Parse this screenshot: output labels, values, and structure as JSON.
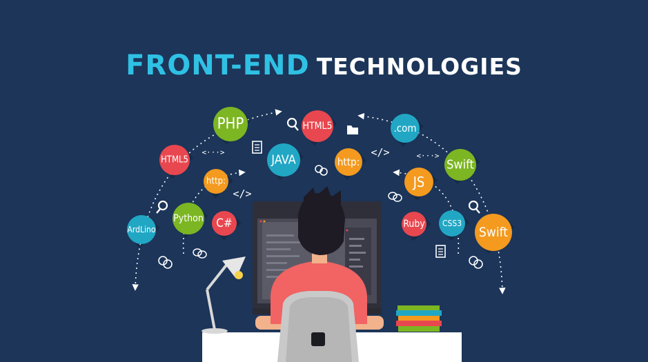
{
  "title": {
    "part1": "FRONT-END",
    "part2": "TECHNOLOGIES"
  },
  "colors": {
    "background": "#1c3559",
    "title_accent": "#2fc1e4",
    "red": "#e8474f",
    "green": "#7cb622",
    "teal": "#21a7c4",
    "orange": "#f39a1f"
  },
  "bubbles": [
    {
      "id": "php",
      "label": "PHP",
      "color": "green"
    },
    {
      "id": "html5-top",
      "label": "HTML5",
      "color": "red"
    },
    {
      "id": "com",
      "label": ".com",
      "color": "teal"
    },
    {
      "id": "html5-left",
      "label": "HTML5",
      "color": "red"
    },
    {
      "id": "java",
      "label": "JAVA",
      "color": "teal"
    },
    {
      "id": "http-center",
      "label": "http:",
      "color": "orange"
    },
    {
      "id": "swift-right",
      "label": "Swift",
      "color": "green"
    },
    {
      "id": "http-left",
      "label": "http:",
      "color": "orange"
    },
    {
      "id": "js",
      "label": "JS",
      "color": "orange"
    },
    {
      "id": "python",
      "label": "Python",
      "color": "green"
    },
    {
      "id": "csharp",
      "label": "C#",
      "color": "red"
    },
    {
      "id": "arduino",
      "label": "ArdLino",
      "color": "teal"
    },
    {
      "id": "ruby",
      "label": "Ruby",
      "color": "red"
    },
    {
      "id": "css3",
      "label": "CSS3",
      "color": "teal"
    },
    {
      "id": "swift-far",
      "label": "Swift",
      "color": "orange"
    }
  ],
  "icons": {
    "search": "search-icon",
    "code": "code-icon",
    "code_dots": "code-dots-icon",
    "document": "document-icon",
    "folder": "folder-icon",
    "link": "link-icon",
    "chat": "chat-icon"
  }
}
